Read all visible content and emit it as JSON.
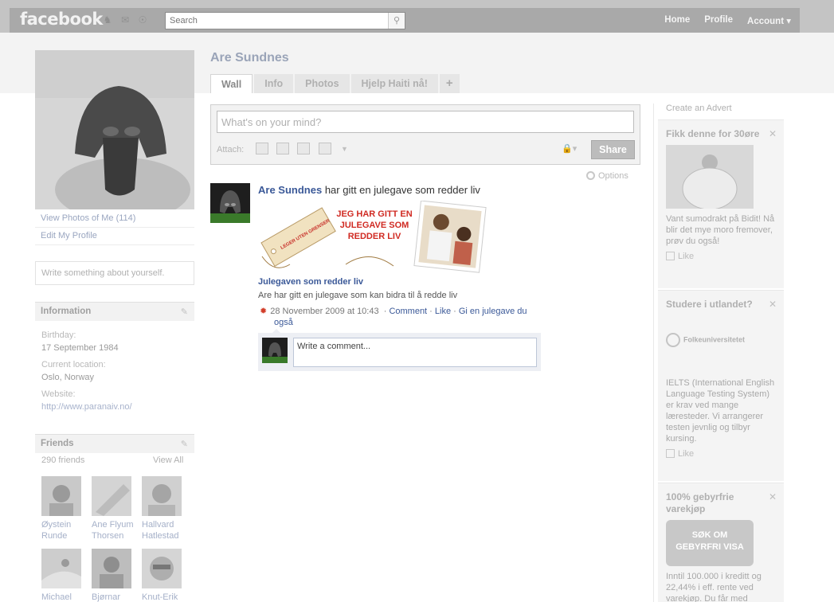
{
  "header": {
    "logo": "facebook",
    "search_placeholder": "Search",
    "nav": {
      "home": "Home",
      "profile": "Profile",
      "account": "Account ▾"
    }
  },
  "profile": {
    "name": "Are Sundnes",
    "tabs": [
      "Wall",
      "Info",
      "Photos",
      "Hjelp Haiti nå!",
      "+"
    ],
    "view_photos": "View Photos of Me (114)",
    "edit_profile": "Edit My Profile",
    "write_placeholder": "Write something about yourself."
  },
  "information": {
    "heading": "Information",
    "birthday_label": "Birthday:",
    "birthday": "17 September 1984",
    "location_label": "Current location:",
    "location": "Oslo, Norway",
    "website_label": "Website:",
    "website": "http://www.paranaiv.no/"
  },
  "friends": {
    "heading": "Friends",
    "count": "290 friends",
    "view_all": "View All",
    "list": [
      {
        "first": "Øystein",
        "last": "Runde"
      },
      {
        "first": "Ane Flyum",
        "last": "Thorsen"
      },
      {
        "first": "Hallvard",
        "last": "Hatlestad"
      },
      {
        "first": "Michael",
        "last": ""
      },
      {
        "first": "Bjørnar",
        "last": ""
      },
      {
        "first": "Knut-Erik",
        "last": ""
      }
    ]
  },
  "composer": {
    "placeholder": "What's on your mind?",
    "attach_label": "Attach:",
    "share_label": "Share"
  },
  "options_label": "Options",
  "post": {
    "author": "Are Sundnes",
    "text": "har gitt en julegave som redder liv",
    "image_text": [
      "JEG HAR GITT EN",
      "JULEGAVE SOM",
      "REDDER LIV"
    ],
    "tag_text": "LEGER UTEN GRENSER",
    "attachment_title": "Julegaven som redder liv",
    "attachment_desc": "Are har gitt en julegave som kan bidra til å redde liv",
    "timestamp": "28 November 2009 at 10:43",
    "comment_link": "Comment",
    "like_link": "Like",
    "app_link": "Gi en julegave du",
    "app_link_2": "også",
    "comment_placeholder": "Write a comment..."
  },
  "sidebar": {
    "create_advert": "Create an Advert",
    "ads": [
      {
        "title": "Fikk denne for 30øre",
        "text": "Vant sumodrakt på Bidit! Nå blir det mye moro fremover, prøv du også!",
        "like": "Like"
      },
      {
        "title": "Studere i utlandet?",
        "logo_text": "Folkeuniversitetet",
        "text": "IELTS (International English Language Testing System) er krav ved mange læresteder. Vi arrangerer testen jevnlig og tilbyr kursing.",
        "like": "Like"
      },
      {
        "title": "100% gebyrfrie varekjøp",
        "image_text": [
          "SØK OM",
          "GEBYRFRI VISA"
        ],
        "text": "Inntil 100.000 i kreditt og 22,44% i eff. rente ved varekjøp. Du får med"
      }
    ]
  }
}
